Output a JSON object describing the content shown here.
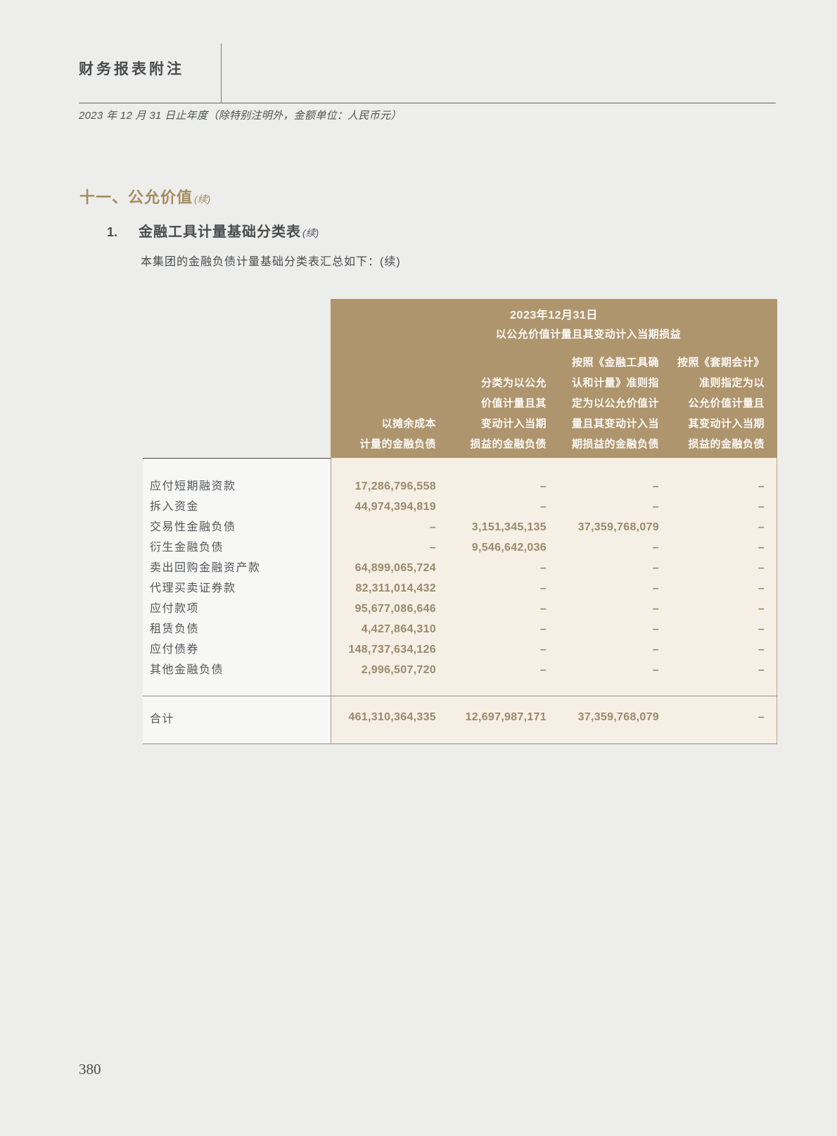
{
  "header": {
    "title": "财务报表附注",
    "subtitle": "2023 年 12 月 31 日止年度（除特别注明外，金额单位：人民币元）"
  },
  "section": {
    "title": "十一、公允价值",
    "continued": "(续)",
    "item_number": "1.",
    "item_title": "金融工具计量基础分类表",
    "item_continued": "(续)",
    "intro": "本集团的金融负债计量基础分类表汇总如下：(续)"
  },
  "table": {
    "date_header": "2023年12月31日",
    "group_header": "以公允价值计量且其变动计入当期损益",
    "columns": [
      {
        "lines": [
          "以摊余成本",
          "计量的金融负债"
        ]
      },
      {
        "lines": [
          "分类为以公允",
          "价值计量且其",
          "变动计入当期",
          "损益的金融负债"
        ]
      },
      {
        "lines": [
          "按照《金融工具确",
          "认和计量》准则指",
          "定为以公允价值计",
          "量且其变动计入当",
          "期损益的金融负债"
        ]
      },
      {
        "lines": [
          "按照《套期会计》",
          "准则指定为以",
          "公允价值计量且",
          "其变动计入当期",
          "损益的金融负债"
        ]
      }
    ],
    "rows": [
      {
        "label": "应付短期融资款",
        "values": [
          "17,286,796,558",
          "–",
          "–",
          "–"
        ]
      },
      {
        "label": "拆入资金",
        "values": [
          "44,974,394,819",
          "–",
          "–",
          "–"
        ]
      },
      {
        "label": "交易性金融负债",
        "values": [
          "–",
          "3,151,345,135",
          "37,359,768,079",
          "–"
        ]
      },
      {
        "label": "衍生金融负债",
        "values": [
          "–",
          "9,546,642,036",
          "–",
          "–"
        ]
      },
      {
        "label": "卖出回购金融资产款",
        "values": [
          "64,899,065,724",
          "–",
          "–",
          "–"
        ]
      },
      {
        "label": "代理买卖证券款",
        "values": [
          "82,311,014,432",
          "–",
          "–",
          "–"
        ]
      },
      {
        "label": "应付款项",
        "values": [
          "95,677,086,646",
          "–",
          "–",
          "–"
        ]
      },
      {
        "label": "租赁负债",
        "values": [
          "4,427,864,310",
          "–",
          "–",
          "–"
        ]
      },
      {
        "label": "应付债券",
        "values": [
          "148,737,634,126",
          "–",
          "–",
          "–"
        ]
      },
      {
        "label": "其他金融负债",
        "values": [
          "2,996,507,720",
          "–",
          "–",
          "–"
        ]
      }
    ],
    "total": {
      "label": "合计",
      "values": [
        "461,310,364,335",
        "12,697,987,171",
        "37,359,768,079",
        "–"
      ]
    }
  },
  "footer": {
    "page_number": "380"
  }
}
